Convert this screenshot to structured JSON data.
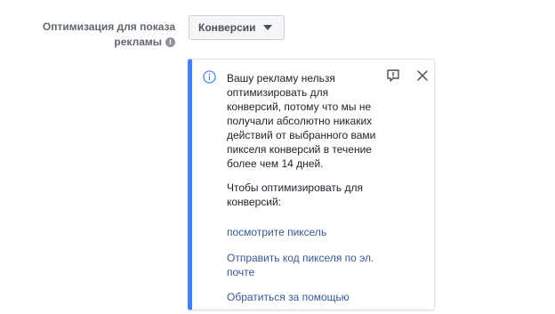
{
  "optimization": {
    "label_line1": "Оптимизация для показа",
    "label_line2": "рекламы",
    "info_symbol": "i",
    "selected_value": "Конверсии"
  },
  "notice": {
    "message": "Вашу рекламу нельзя оптимизировать для конверсий, потому что мы не получали абсолютно никаких действий от выбранного вами пикселя конверсий в течение более чем 14 дней.",
    "instruction": "Чтобы оптимизировать для конверсий:",
    "links": [
      "посмотрите пиксель",
      "Отправить код пикселя по эл. почте",
      "Обратиться за помощью"
    ],
    "accent_color": "#4080ff",
    "link_color": "#365899"
  }
}
